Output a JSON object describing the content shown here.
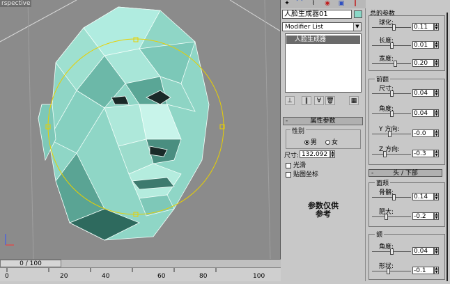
{
  "viewport": {
    "label": "rspective",
    "time_slider": "0 / 100",
    "ruler_ticks": [
      "0",
      "20",
      "40",
      "60",
      "80",
      "100"
    ]
  },
  "command_panel": {
    "object_name": "人脸生成器01",
    "object_color": "#8ad8c8",
    "modifier_list": "Modifier List",
    "stack_item": "人脸生成器",
    "rollout_title": "属性参数",
    "gender_title": "性别",
    "gender_male": "男",
    "gender_female": "女",
    "size_label": "尺寸:",
    "size_value": "132.092",
    "smooth_label": "光滑",
    "mapcoords_label": "贴图坐标",
    "note": "参数仅供\n参考"
  },
  "params": {
    "general_title": "总的参数",
    "general": [
      {
        "label": "球化:",
        "value": "0.11",
        "frac": 0.55
      },
      {
        "label": "长度:",
        "value": "0.01",
        "frac": 0.5
      },
      {
        "label": "宽度:",
        "value": "0.20",
        "frac": 0.6
      }
    ],
    "forehead_title": "前额",
    "forehead": [
      {
        "label": "尺寸:",
        "value": "0.04",
        "frac": 0.5
      },
      {
        "label": "角度:",
        "value": "0.04",
        "frac": 0.5
      },
      {
        "label": "Y 方向:",
        "value": "-0.0",
        "frac": 0.45
      },
      {
        "label": "Z 方向:",
        "value": "-0.3",
        "frac": 0.3
      }
    ],
    "head_section": "头 / 下部",
    "cheek_title": "面颊",
    "cheek": [
      {
        "label": "骨骼:",
        "value": "0.14",
        "frac": 0.55
      },
      {
        "label": "肥大:",
        "value": "-0.2",
        "frac": 0.35
      }
    ],
    "chin_title": "颌",
    "chin": [
      {
        "label": "角度:",
        "value": "0.04",
        "frac": 0.5
      },
      {
        "label": "形状:",
        "value": "-0.1",
        "frac": 0.4
      }
    ]
  }
}
